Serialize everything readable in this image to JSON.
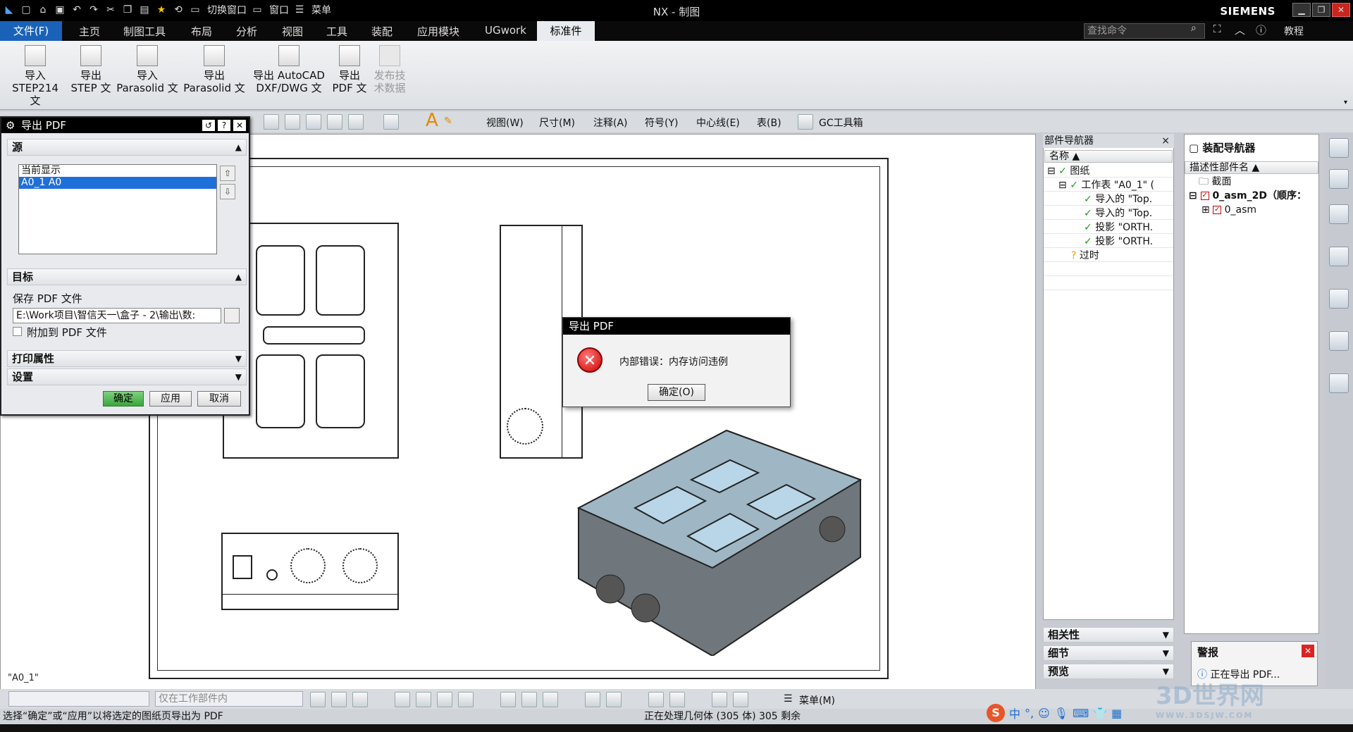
{
  "titlebar": {
    "window_title": "NX - 制图",
    "brand": "SIEMENS",
    "switch_window": "切换窗口",
    "window_menu": "窗口",
    "menu": "菜单"
  },
  "menubar": {
    "file": "文件(F)",
    "items": [
      "主页",
      "制图工具",
      "布局",
      "分析",
      "视图",
      "工具",
      "装配",
      "应用模块",
      "UGwork",
      "标准件"
    ],
    "active": "标准件",
    "search_placeholder": "查找命令",
    "tutorial": "教程"
  },
  "ribbon": {
    "buttons": [
      {
        "l1": "导入",
        "l2": "STEP214 文"
      },
      {
        "l1": "导出",
        "l2": "STEP 文"
      },
      {
        "l1": "导入",
        "l2": "Parasolid 文"
      },
      {
        "l1": "导出",
        "l2": "Parasolid 文"
      },
      {
        "l1": "导出 AutoCAD",
        "l2": "DXF/DWG 文"
      },
      {
        "l1": "导出",
        "l2": "PDF 文"
      },
      {
        "l1": "发布技",
        "l2": "术数据"
      }
    ]
  },
  "toolbar2": {
    "view": "视图(W)",
    "dim": "尺寸(M)",
    "note": "注释(A)",
    "symbol": "符号(Y)",
    "centerline": "中心线(E)",
    "table": "表(B)",
    "gc": "GC工具箱"
  },
  "pdf_dialog": {
    "title": "导出 PDF",
    "source": "源",
    "list": [
      "当前显示",
      "A0_1  A0"
    ],
    "selected_index": 1,
    "target": "目标",
    "save_label": "保存 PDF 文件",
    "path": "E:\\Work项目\\智信天一\\盒子 - 2\\输出\\数:",
    "append": "附加到 PDF 文件",
    "print_props": "打印属性",
    "settings": "设置",
    "ok": "确定",
    "apply": "应用",
    "cancel": "取消"
  },
  "error_dialog": {
    "title": "导出 PDF",
    "message": "内部错误：内存访问违例",
    "ok": "确定(O)"
  },
  "sheet": {
    "name": "\"A0_1\""
  },
  "part_navigator": {
    "title": "部件导航器",
    "col_name": "名称",
    "rows": [
      "图纸",
      "工作表 \"A0_1\" (",
      "导入的 \"Top.",
      "导入的 \"Top.",
      "投影 \"ORTH.",
      "投影 \"ORTH.",
      "过时"
    ],
    "relevance": "相关性",
    "details": "细节",
    "preview": "预览"
  },
  "assembly_navigator": {
    "title": "装配导航器",
    "col_name": "描述性部件名",
    "rows": [
      "截面",
      "0_asm_2D（顺序：",
      "0_asm"
    ]
  },
  "alert": {
    "title": "警报",
    "text": "正在导出 PDF..."
  },
  "bottombar": {
    "filter": "仅在工作部件内",
    "menu": "菜单(M)"
  },
  "status": {
    "left": "选择“确定”或“应用”以将选定的图纸页导出为 PDF",
    "center": "正在处理几何体 (305 体) 305 剩余"
  },
  "ime": {
    "lang": "中"
  },
  "watermark": {
    "text": "3D世界网",
    "url": "WWW.3DSJW.COM"
  }
}
